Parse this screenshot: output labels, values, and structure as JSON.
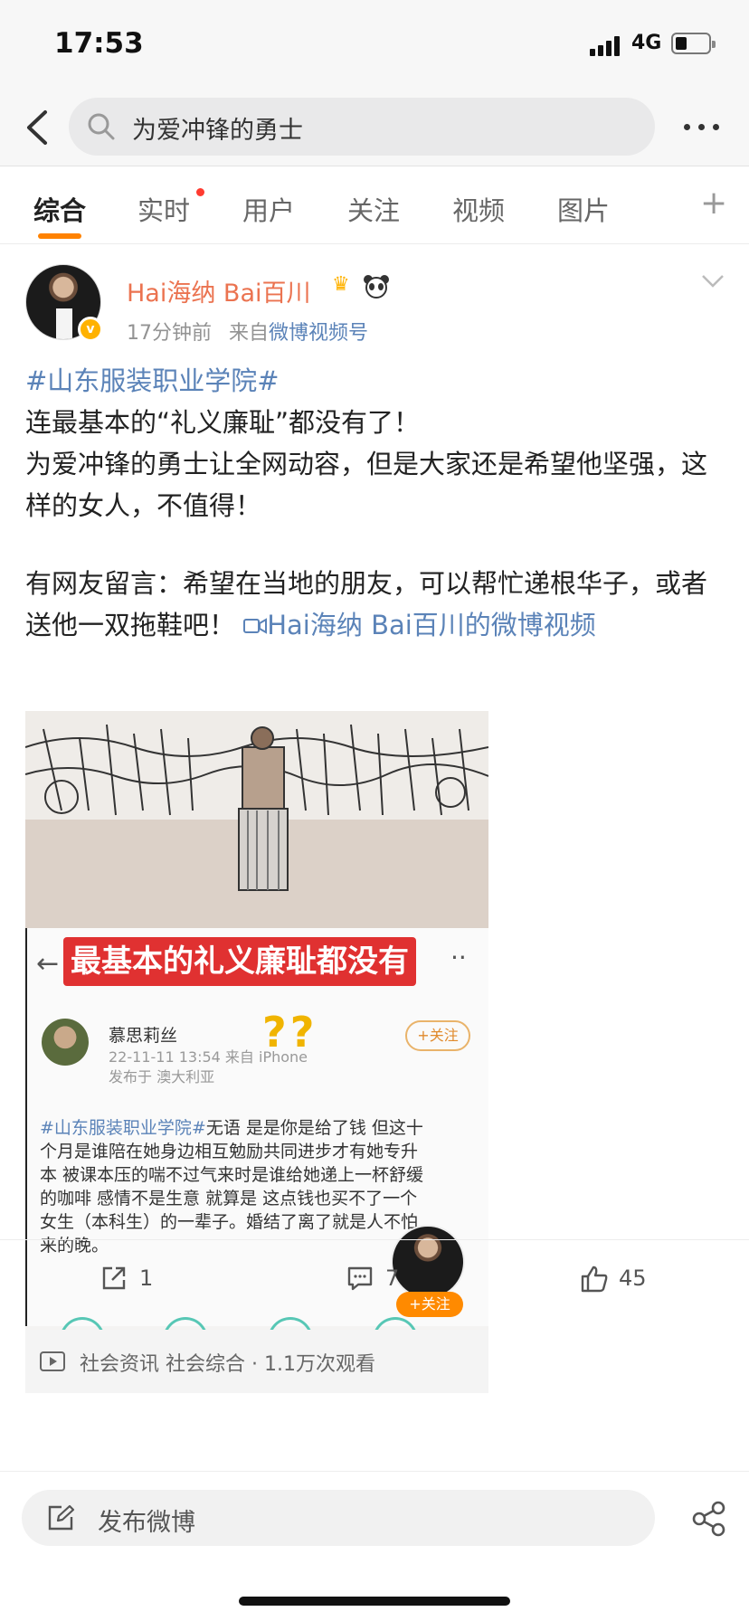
{
  "status_bar": {
    "time": "17:53",
    "network": "4G"
  },
  "search": {
    "query": "为爱冲锋的勇士"
  },
  "tabs": [
    {
      "label": "综合"
    },
    {
      "label": "实时"
    },
    {
      "label": "用户"
    },
    {
      "label": "关注"
    },
    {
      "label": "视频"
    },
    {
      "label": "图片"
    }
  ],
  "post": {
    "author": "Hai海纳 Bai百川",
    "time": "17分钟前",
    "source_prefix": "来自",
    "source": "微博视频号",
    "hashtag": "#山东服装职业学院#",
    "line1": "连最基本的“礼义廉耻”都没有了！",
    "line2": "为爱冲锋的勇士让全网动容，但是大家还是希望他坚强，这样的女人，不值得！",
    "line3": "有网友留言：希望在当地的朋友，可以帮忙递根华子，或者送他一双拖鞋吧！",
    "video_link": "Hai海纳 Bai百川的微博视频",
    "media": {
      "overlay_title": "最基本的礼义廉耻都没有",
      "commenter_name": "慕思莉丝",
      "commenter_time": "22-11-11 13:54",
      "commenter_from": "来自 iPhone",
      "commenter_location": "发布于 澳大利亚",
      "follow_label": "+关注",
      "comment_tag": "#山东服装职业学院#",
      "comment_body": "无语 是是你是给了钱 但这十个月是谁陪在她身边相互勉励共同进步才有她专升本 被课本压的喘不过气来时是谁给她递上一杯舒缓的咖啡 感情不是生意 就算是 这点钱也买不了一个女生（本科生）的一辈子。婚结了离了就是人不怕来的晚。",
      "overlay_follow": "+关注",
      "caption": "社会资讯 社会综合 · 1.1万次观看"
    },
    "actions": {
      "repost": "1",
      "comment": "7",
      "like": "45"
    }
  },
  "composer": {
    "placeholder": "发布微博"
  }
}
